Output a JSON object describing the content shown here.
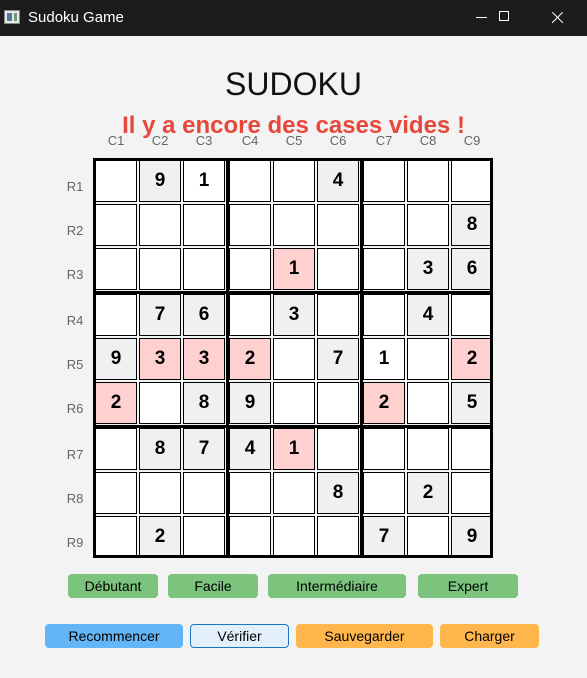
{
  "window": {
    "title": "Sudoku Game"
  },
  "game": {
    "title": "SUDOKU",
    "status_message": "Il y a encore des cases vides !"
  },
  "grid": {
    "col_labels": [
      "C1",
      "C2",
      "C3",
      "C4",
      "C5",
      "C6",
      "C7",
      "C8",
      "C9"
    ],
    "row_labels": [
      "R1",
      "R2",
      "R3",
      "R4",
      "R5",
      "R6",
      "R7",
      "R8",
      "R9"
    ],
    "cells": [
      [
        "",
        "9",
        "1",
        "",
        "",
        "4",
        "",
        "",
        ""
      ],
      [
        "",
        "",
        "",
        "",
        "",
        "",
        "",
        "",
        "8"
      ],
      [
        "",
        "",
        "",
        "",
        "1",
        "",
        "",
        "3",
        "6"
      ],
      [
        "",
        "7",
        "6",
        "",
        "3",
        "",
        "",
        "4",
        ""
      ],
      [
        "9",
        "3",
        "3",
        "2",
        "",
        "7",
        "1",
        "",
        "2"
      ],
      [
        "2",
        "",
        "8",
        "9",
        "",
        "",
        "2",
        "",
        "5"
      ],
      [
        "",
        "8",
        "7",
        "4",
        "1",
        "",
        "",
        "",
        ""
      ],
      [
        "",
        "",
        "",
        "",
        "",
        "8",
        "",
        "2",
        ""
      ],
      [
        "",
        "2",
        "",
        "",
        "",
        "",
        "7",
        "",
        "9"
      ]
    ],
    "given": [
      [
        false,
        true,
        false,
        false,
        false,
        true,
        false,
        false,
        false
      ],
      [
        false,
        false,
        false,
        false,
        false,
        false,
        false,
        false,
        true
      ],
      [
        false,
        false,
        false,
        false,
        false,
        false,
        false,
        true,
        true
      ],
      [
        false,
        true,
        true,
        false,
        true,
        false,
        false,
        true,
        false
      ],
      [
        true,
        false,
        false,
        false,
        false,
        true,
        false,
        false,
        false
      ],
      [
        false,
        false,
        true,
        true,
        false,
        false,
        false,
        false,
        true
      ],
      [
        false,
        true,
        true,
        true,
        false,
        false,
        false,
        false,
        false
      ],
      [
        false,
        false,
        false,
        false,
        false,
        true,
        false,
        true,
        false
      ],
      [
        false,
        true,
        false,
        false,
        false,
        false,
        true,
        false,
        true
      ]
    ],
    "conflicts": [
      [
        4,
        1
      ],
      [
        4,
        2
      ],
      [
        4,
        3
      ],
      [
        4,
        8
      ],
      [
        5,
        0
      ],
      [
        5,
        6
      ],
      [
        2,
        4
      ],
      [
        6,
        4
      ]
    ]
  },
  "difficulty": {
    "beginner_label": "Débutant",
    "easy_label": "Facile",
    "intermediate_label": "Intermédiaire",
    "expert_label": "Expert"
  },
  "actions": {
    "restart_label": "Recommencer",
    "check_label": "Vérifier",
    "save_label": "Sauvegarder",
    "load_label": "Charger"
  },
  "colors": {
    "status": "#e8473b",
    "conflict": "#ffd0d0",
    "given": "#f0f0f0",
    "difficulty_buttons": "#7cc47e",
    "restart_button": "#64b5f6",
    "save_load_buttons": "#ffb74d"
  }
}
